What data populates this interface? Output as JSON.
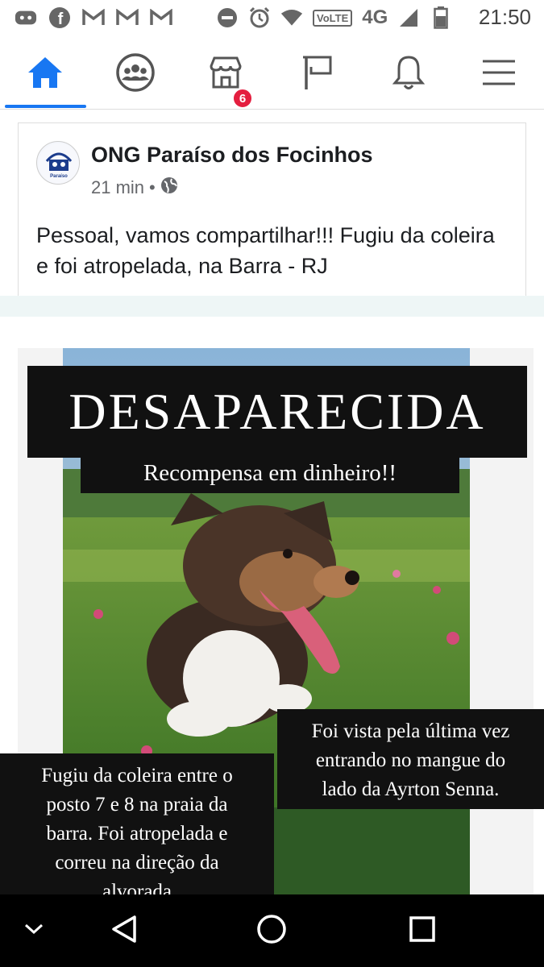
{
  "status_bar": {
    "time": "21:50",
    "network_badge": "VoLTE",
    "network_type": "4G",
    "icons": [
      "discord-icon",
      "facebook-icon",
      "gmail-icon",
      "gmail-icon",
      "gmail-icon",
      "do-not-disturb-icon",
      "alarm-icon",
      "wifi-icon",
      "signal-icon",
      "battery-icon"
    ]
  },
  "nav": {
    "items": [
      "home-icon",
      "groups-icon",
      "marketplace-icon",
      "pages-flag-icon",
      "notifications-bell-icon",
      "menu-icon"
    ],
    "marketplace_badge": "6",
    "accent": "#1877f2"
  },
  "post": {
    "page_name": "ONG Paraíso dos Focinhos",
    "time": "21 min",
    "separator": "•",
    "privacy": "globe-icon",
    "text": "Pessoal, vamos compartilhar!!! Fugiu da coleira e foi atropelada, na Barra - RJ",
    "avatar_caption": "Paraíso"
  },
  "poster": {
    "headline": "DESAPARECIDA",
    "subheadline": "Recompensa em dinheiro!!",
    "right_box": [
      "Foi vista pela última vez",
      "entrando no mangue do",
      "lado da Ayrton Senna."
    ],
    "left_box": [
      "Fugiu da coleira entre o",
      "posto 7 e 8 na praia da",
      "barra. Foi atropelada e",
      "correu na direção da",
      "alvorada"
    ]
  },
  "system_nav": [
    "chevron-down-icon",
    "back-triangle-icon",
    "home-circle-icon",
    "recents-square-icon"
  ]
}
